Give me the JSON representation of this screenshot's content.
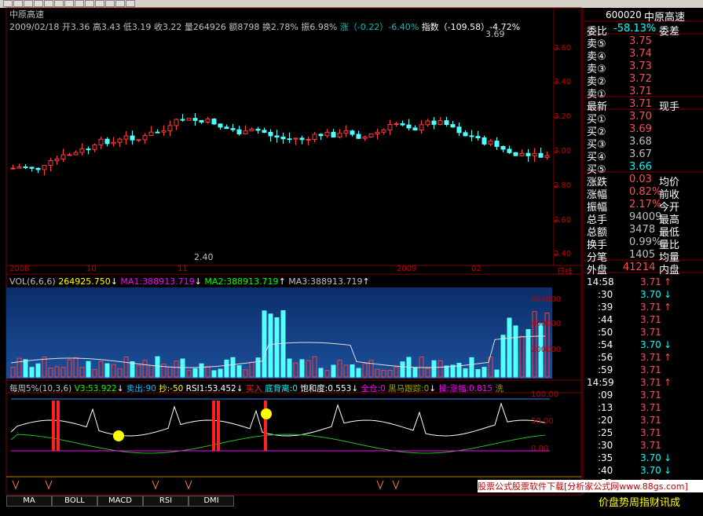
{
  "stock": {
    "name": "中原高速",
    "code": "600020"
  },
  "header": {
    "date": "2009/02/18",
    "open": "开3.36",
    "high": "高3.43",
    "low": "低3.19",
    "close": "收3.22",
    "volume": "量264926",
    "amount": "额8798",
    "turnover": "换2.78%",
    "amplitude": "振6.98%",
    "change": "涨（-0.22）-6.40%",
    "index": "指数（-109.58）-4.72%"
  },
  "price_axis": [
    "3.60",
    "3.40",
    "3.20",
    "3.00",
    "2.80",
    "2.60",
    "2.40"
  ],
  "price_marks": {
    "max": "3.69",
    "min": "2.40"
  },
  "date_axis": [
    "2008",
    "10",
    "11",
    "2009",
    "02"
  ],
  "date_axis_tail": "日线",
  "vol_header": {
    "title": "VOL(6,6,6)",
    "vol": "264925.750",
    "ma1": "MA1:388913.719",
    "ma2": "MA2:388913.719",
    "ma3": "MA3:388913.719"
  },
  "vol_axis": [
    "600000",
    "400000",
    "200000"
  ],
  "ind_header": {
    "title": "每周5%(10,3,6)",
    "v3": "V3:53.922",
    "sell": "卖出:90",
    "buy": "抄:-50",
    "rsi": "RSI1:53.452",
    "buy_signal": "买入",
    "bottom": "底背离:0",
    "sat": "饱和度:0.553",
    "full": "全仓:0",
    "track": "黑马跟踪:0",
    "hit": "操:涨幅:0.815",
    "tail": "洗"
  },
  "ind_axis": [
    "100.00",
    "50.00",
    "0.00"
  ],
  "quote": {
    "ratio": {
      "l1": "委比",
      "v1": "-58.13%",
      "l2": "委差",
      "v2": ""
    },
    "sells": [
      {
        "l": "卖⑤",
        "v": "3.75"
      },
      {
        "l": "卖④",
        "v": "3.74"
      },
      {
        "l": "卖③",
        "v": "3.73"
      },
      {
        "l": "卖②",
        "v": "3.72"
      },
      {
        "l": "卖①",
        "v": "3.71"
      }
    ],
    "last": {
      "l": "最新",
      "v": "3.71",
      "l2": "现手"
    },
    "buys": [
      {
        "l": "买①",
        "v": "3.70"
      },
      {
        "l": "买②",
        "v": "3.69"
      },
      {
        "l": "买③",
        "v": "3.68"
      },
      {
        "l": "买④",
        "v": "3.67"
      },
      {
        "l": "买⑤",
        "v": "3.66"
      }
    ],
    "stats": [
      {
        "l": "涨跌",
        "v": "0.03",
        "l2": "均价"
      },
      {
        "l": "涨幅",
        "v": "0.82%",
        "l2": "前收"
      },
      {
        "l": "振幅",
        "v": "2.17%",
        "l2": "今开"
      },
      {
        "l": "总手",
        "v": "94009",
        "l2": "最高"
      },
      {
        "l": "总额",
        "v": "3478",
        "l2": "最低"
      },
      {
        "l": "换手",
        "v": "0.99%",
        "l2": "量比"
      },
      {
        "l": "分笔",
        "v": "1405",
        "l2": "均量"
      }
    ],
    "outer": {
      "l": "外盘",
      "v": "41214",
      "l2": "内盘"
    }
  },
  "ticks": [
    {
      "t": "14:58",
      "p": "3.71",
      "a": "↑"
    },
    {
      "t": ":30",
      "p": "3.70",
      "a": "↓"
    },
    {
      "t": ":39",
      "p": "3.71",
      "a": "↑"
    },
    {
      "t": ":44",
      "p": "3.71",
      "a": ""
    },
    {
      "t": ":50",
      "p": "3.71",
      "a": ""
    },
    {
      "t": ":54",
      "p": "3.70",
      "a": "↓"
    },
    {
      "t": ":56",
      "p": "3.71",
      "a": "↑"
    },
    {
      "t": ":59",
      "p": "3.71",
      "a": ""
    },
    {
      "t": "14:59",
      "p": "3.71",
      "a": "↑"
    },
    {
      "t": ":09",
      "p": "3.71",
      "a": ""
    },
    {
      "t": ":13",
      "p": "3.71",
      "a": ""
    },
    {
      "t": ":20",
      "p": "3.71",
      "a": ""
    },
    {
      "t": ":25",
      "p": "3.71",
      "a": ""
    },
    {
      "t": ":30",
      "p": "3.71",
      "a": ""
    },
    {
      "t": ":35",
      "p": "3.70",
      "a": "↓"
    },
    {
      "t": ":40",
      "p": "3.70",
      "a": "↓"
    },
    {
      "t": ":51",
      "p": "3.71",
      "a": "↑"
    }
  ],
  "tabs": [
    "MA",
    "BOLL",
    "MACD",
    "RSI",
    "DMI"
  ],
  "ad": "股票公式股票软件下载[分析家公式网www.88gs.com]",
  "footer": "价盘势周指财讯成"
}
